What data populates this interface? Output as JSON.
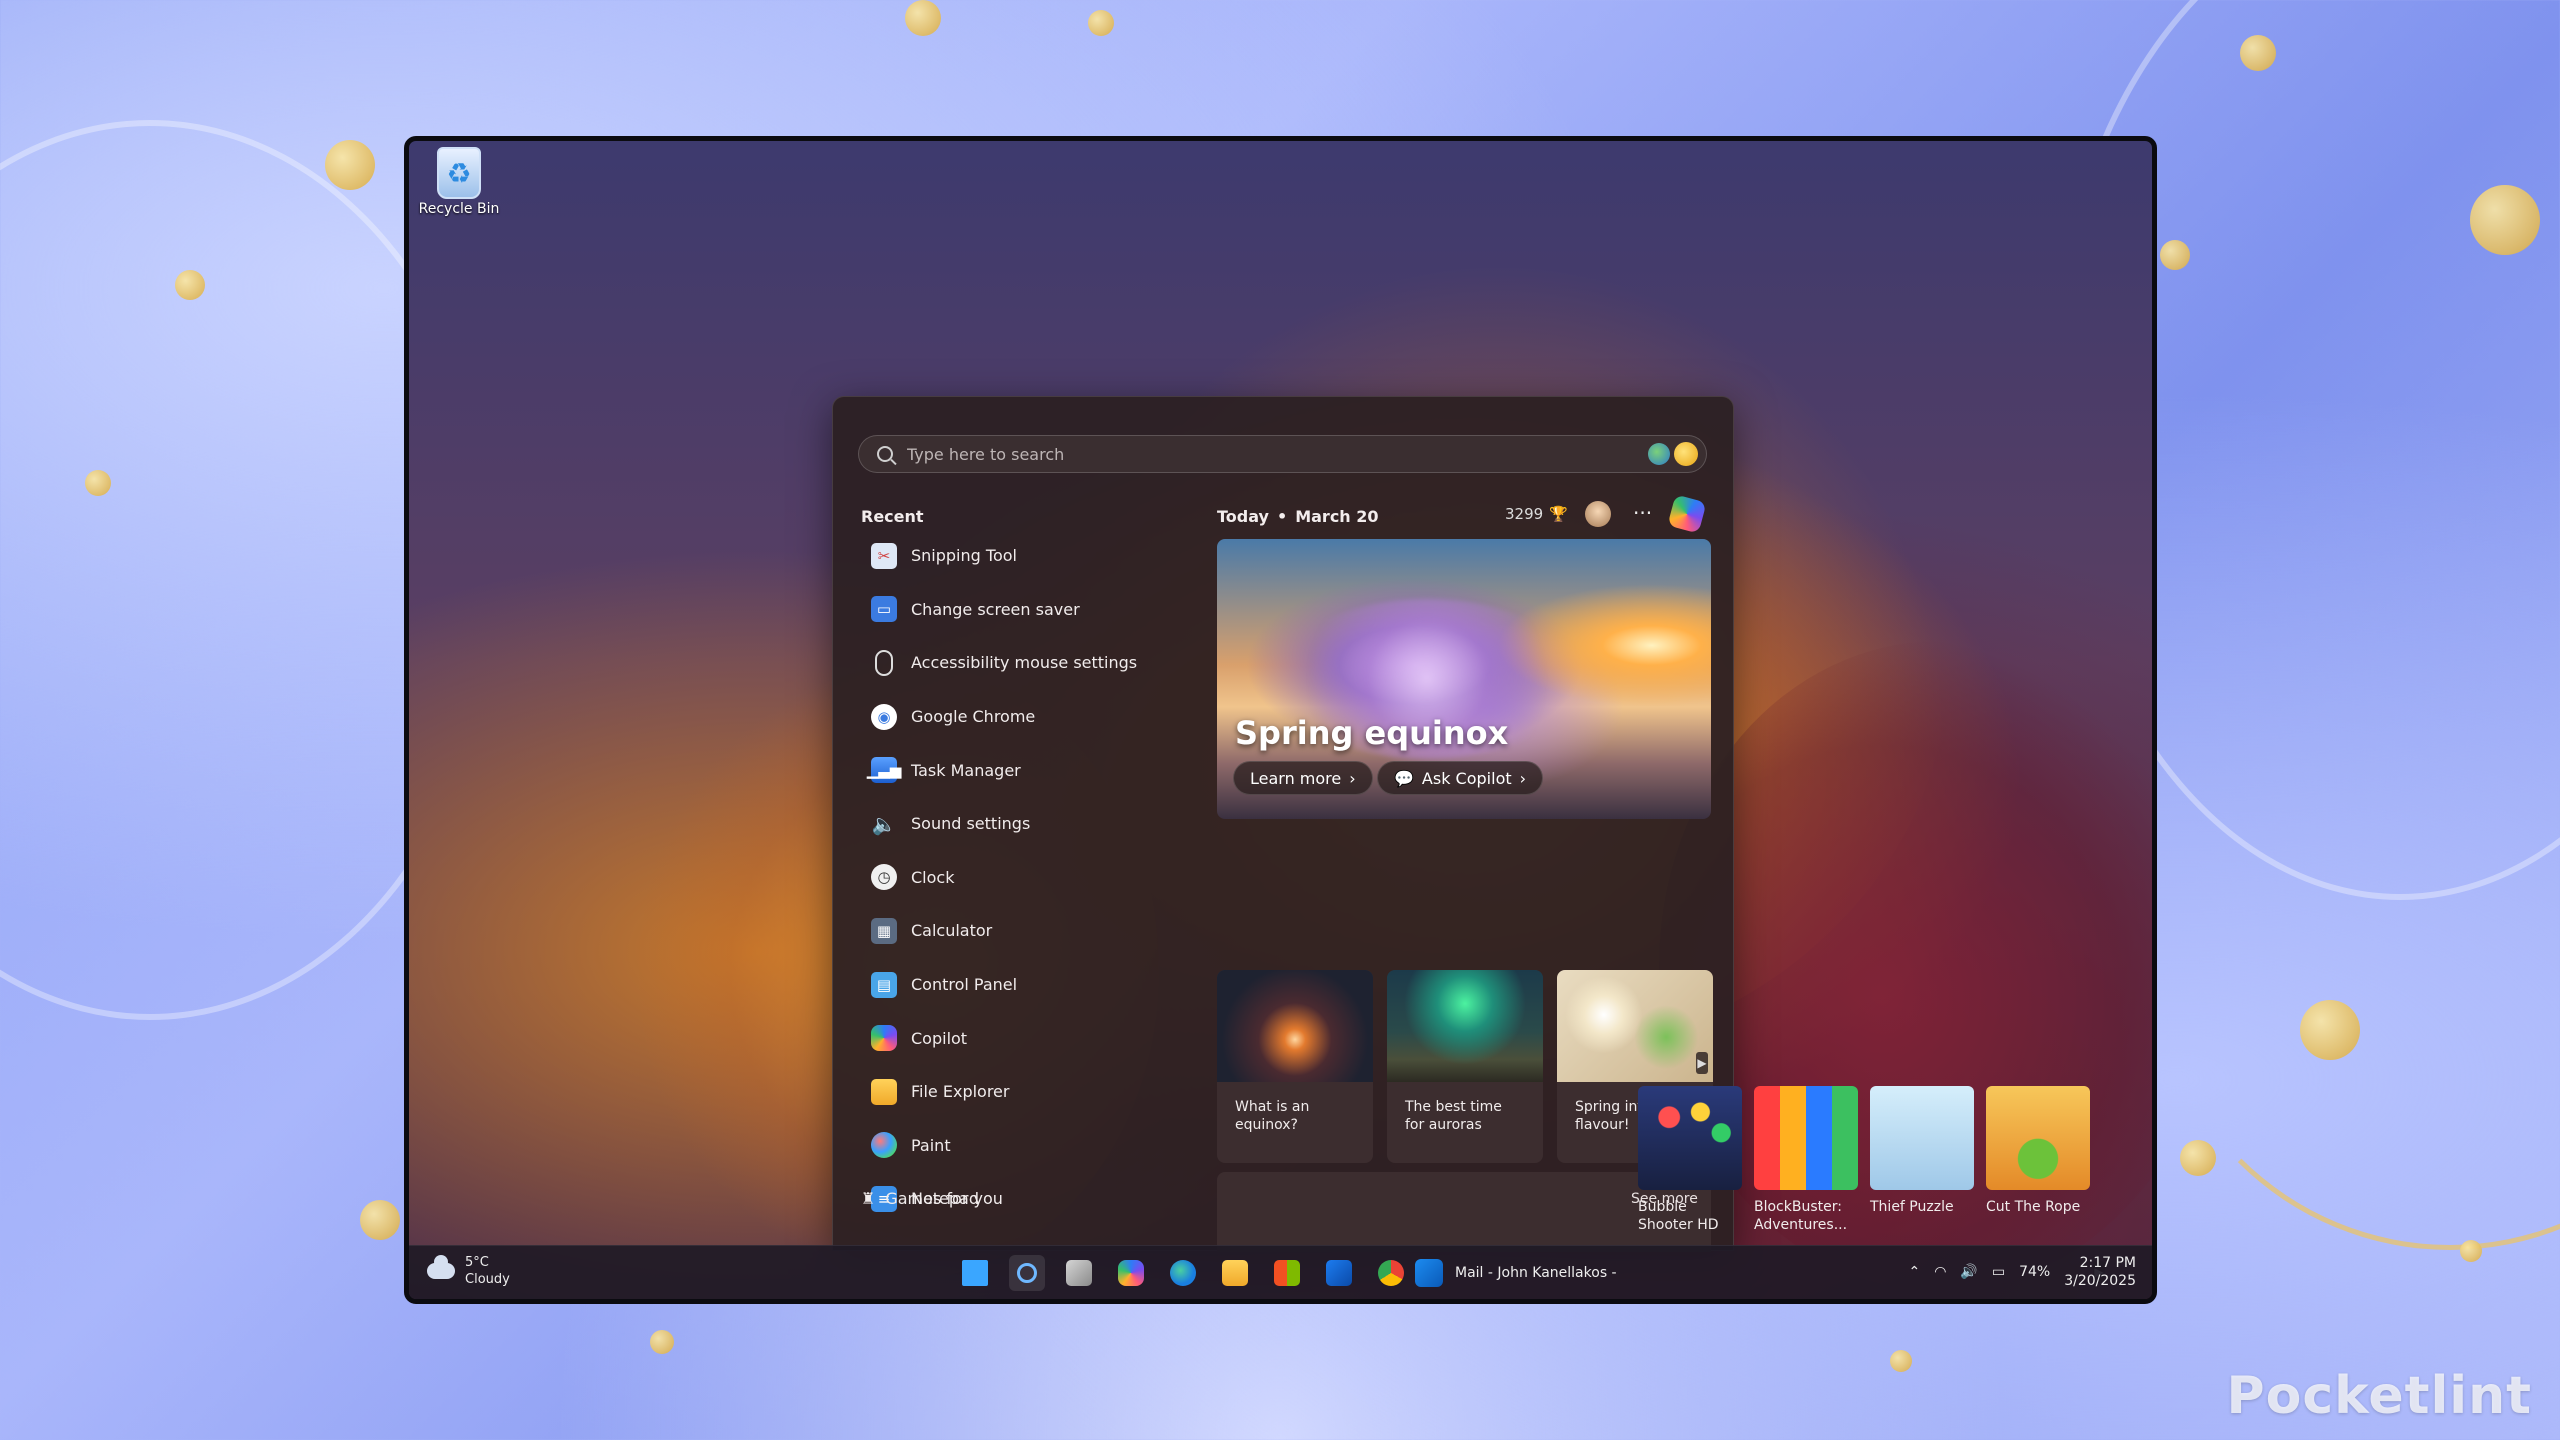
{
  "desktop": {
    "recycle_bin_label": "Recycle Bin"
  },
  "search": {
    "placeholder": "Type here to search"
  },
  "recent": {
    "heading": "Recent",
    "items": [
      {
        "label": "Snipping Tool",
        "icon": "snipping-tool-icon"
      },
      {
        "label": "Change screen saver",
        "icon": "screen-saver-icon"
      },
      {
        "label": "Accessibility mouse settings",
        "icon": "mouse-icon"
      },
      {
        "label": "Google Chrome",
        "icon": "chrome-icon"
      },
      {
        "label": "Task Manager",
        "icon": "task-manager-icon"
      },
      {
        "label": "Sound settings",
        "icon": "speaker-icon"
      },
      {
        "label": "Clock",
        "icon": "clock-icon"
      },
      {
        "label": "Calculator",
        "icon": "calculator-icon"
      },
      {
        "label": "Control Panel",
        "icon": "control-panel-icon"
      },
      {
        "label": "Copilot",
        "icon": "copilot-icon"
      },
      {
        "label": "File Explorer",
        "icon": "folder-icon"
      },
      {
        "label": "Paint",
        "icon": "paint-icon"
      },
      {
        "label": "Notepad",
        "icon": "notepad-icon"
      }
    ]
  },
  "today": {
    "label": "Today",
    "date": "March 20",
    "points": "3299"
  },
  "hero": {
    "title": "Spring equinox",
    "learn_more": "Learn more",
    "ask_copilot": "Ask Copilot"
  },
  "cards": [
    {
      "caption": "What is an equinox?"
    },
    {
      "caption": "The best time for auroras"
    },
    {
      "caption": "Spring into flavour!"
    }
  ],
  "games": {
    "heading": "Games for you",
    "see_more": "See more",
    "items": [
      {
        "name": "Bubble Shooter HD"
      },
      {
        "name": "BlockBuster: Adventures..."
      },
      {
        "name": "Thief Puzzle"
      },
      {
        "name": "Cut The Rope"
      }
    ]
  },
  "taskbar": {
    "weather_temp": "5°C",
    "weather_cond": "Cloudy",
    "mail_label": "Mail - John Kanellakos -",
    "battery": "74%",
    "time": "2:17 PM",
    "date": "3/20/2025"
  },
  "watermark": "Pocketlint"
}
